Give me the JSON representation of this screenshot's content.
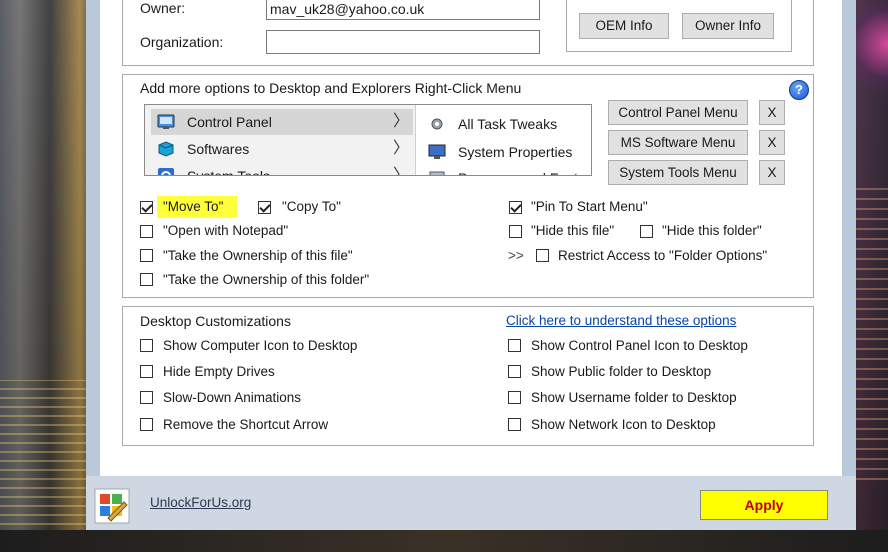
{
  "window": {
    "owner_label": "Owner:",
    "owner_value": "mav_uk28@yahoo.co.uk",
    "organization_label": "Organization:",
    "organization_value": "",
    "oem_info_button": "OEM Info",
    "owner_info_button": "Owner Info"
  },
  "context_menu_section": {
    "title": "Add more options to Desktop and Explorers Right-Click Menu",
    "help_icon": "?",
    "menu_items": [
      {
        "label": "Control Panel",
        "icon": "control-panel-icon",
        "selected": true
      },
      {
        "label": "Softwares",
        "icon": "softwares-icon",
        "selected": false
      },
      {
        "label": "System Tools",
        "icon": "system-tools-icon",
        "selected": false
      }
    ],
    "submenu_items": [
      {
        "label": "All Task Tweaks",
        "icon": "gear-icon"
      },
      {
        "label": "System Properties",
        "icon": "monitor-icon"
      },
      {
        "label": "Programs and Featu",
        "icon": "programs-icon"
      }
    ],
    "side_buttons": [
      {
        "label": "Control Panel Menu",
        "remove": "X"
      },
      {
        "label": "MS Software Menu",
        "remove": "X"
      },
      {
        "label": "System Tools Menu",
        "remove": "X"
      }
    ],
    "options": {
      "move_to": {
        "label": "\"Move To\"",
        "checked": true
      },
      "copy_to": {
        "label": "\"Copy To\"",
        "checked": true
      },
      "pin_to_start": {
        "label": "\"Pin To Start Menu\"",
        "checked": true
      },
      "open_with_notepad": {
        "label": "\"Open with Notepad\"",
        "checked": false
      },
      "hide_this_file": {
        "label": "\"Hide this file\"",
        "checked": false
      },
      "hide_this_folder": {
        "label": "\"Hide this folder\"",
        "checked": false
      },
      "take_ownership_file": {
        "label": "\"Take the Ownership of this file\"",
        "checked": false
      },
      "restrict_access_prefix": ">>",
      "restrict_access": {
        "label": "Restrict Access to \"Folder Options\"",
        "checked": false
      },
      "take_ownership_folder": {
        "label": "\"Take the Ownership of this folder\"",
        "checked": false
      }
    }
  },
  "desktop_section": {
    "title": "Desktop Customizations",
    "link": "Click here to understand these options",
    "left_options": [
      "Show Computer Icon to Desktop",
      "Hide Empty Drives",
      "Slow-Down Animations",
      "Remove the Shortcut Arrow"
    ],
    "right_options": [
      "Show Control Panel Icon to Desktop",
      "Show Public folder to Desktop",
      "Show Username folder to Desktop",
      "Show Network Icon to Desktop"
    ]
  },
  "footer": {
    "link": "UnlockForUs.org",
    "apply_button": "Apply"
  },
  "colors": {
    "highlight": "#ffff3a",
    "apply_bg": "#ffff00",
    "apply_text": "#c00000",
    "link": "#0645ad"
  }
}
